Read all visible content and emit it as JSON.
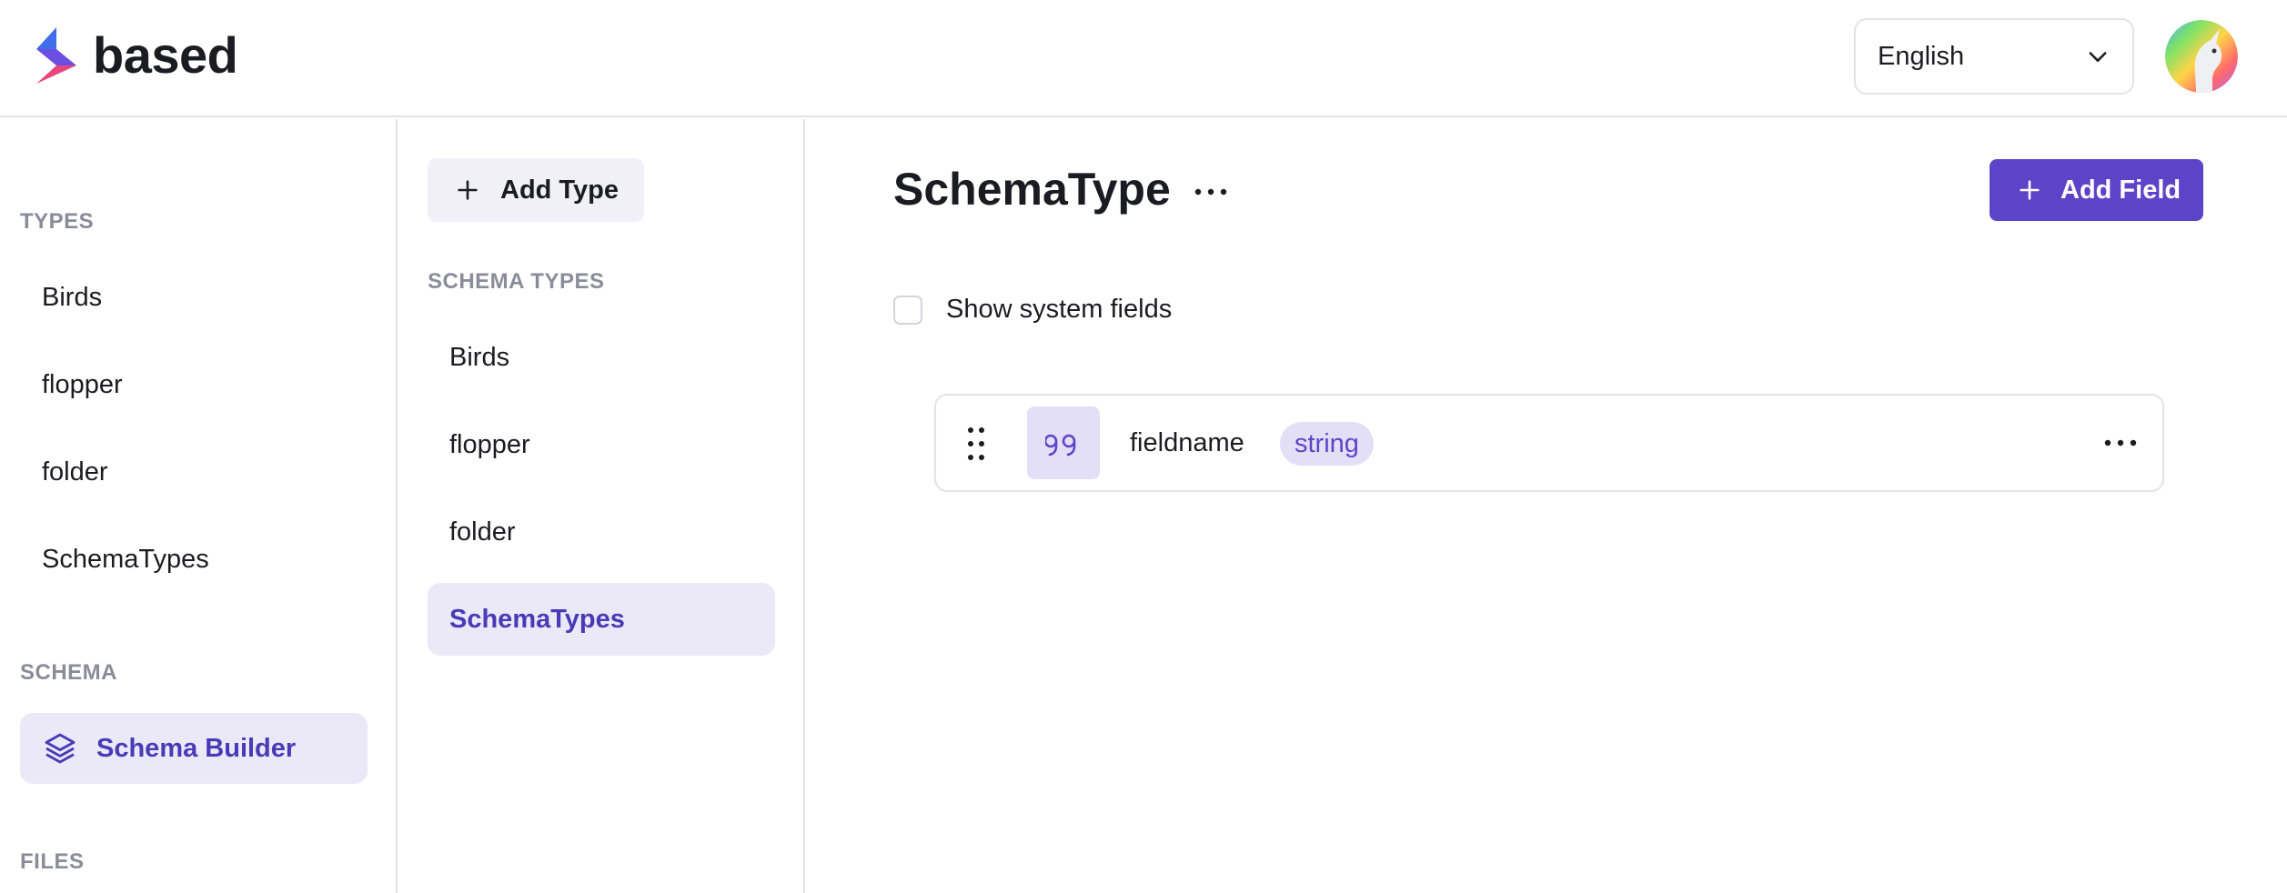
{
  "app": {
    "name": "based"
  },
  "header": {
    "language": {
      "selected": "English"
    },
    "icons": {
      "chevron": "chevron-down-icon",
      "avatar": "unicorn-avatar"
    }
  },
  "sidebar": {
    "types_title": "TYPES",
    "types": [
      {
        "label": "Birds"
      },
      {
        "label": "flopper"
      },
      {
        "label": "folder"
      },
      {
        "label": "SchemaTypes"
      }
    ],
    "schema_title": "SCHEMA",
    "schema_items": [
      {
        "label": "Schema Builder",
        "icon": "layers-icon",
        "active": true
      }
    ],
    "files_title": "FILES"
  },
  "schema_panel": {
    "add_type_label": "Add Type",
    "title": "SCHEMA TYPES",
    "items": [
      {
        "label": "Birds"
      },
      {
        "label": "flopper"
      },
      {
        "label": "folder"
      },
      {
        "label": "SchemaTypes",
        "active": true
      }
    ]
  },
  "main": {
    "title": "SchemaType",
    "add_field_label": "Add Field",
    "show_system_fields_label": "Show system fields",
    "show_system_fields_checked": false,
    "fields": [
      {
        "name": "fieldname",
        "type": "string",
        "icon": "quote-icon"
      }
    ]
  },
  "colors": {
    "accent": "#5c44c8",
    "accent_light": "#ebe9f8",
    "badge_bg": "#e3dff7",
    "muted_text": "#8a8c99",
    "border": "#e3e3e8"
  }
}
